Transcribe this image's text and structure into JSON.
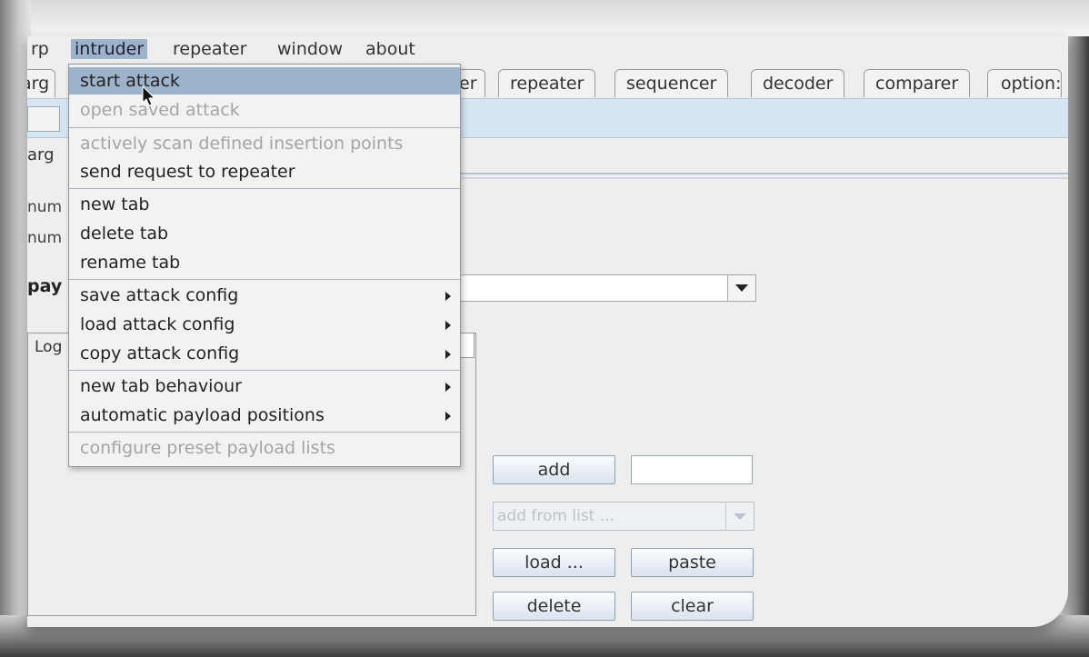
{
  "menubar": {
    "items": [
      {
        "label": "rp"
      },
      {
        "label": "intruder",
        "active": true
      },
      {
        "label": "repeater"
      },
      {
        "label": "window"
      },
      {
        "label": "about"
      }
    ]
  },
  "tabs": [
    {
      "label": "arg"
    },
    {
      "label": "er"
    },
    {
      "label": "repeater"
    },
    {
      "label": "sequencer"
    },
    {
      "label": "decoder"
    },
    {
      "label": "comparer"
    },
    {
      "label": "option:"
    }
  ],
  "subtab_label": "arg",
  "left_labels": {
    "num1": "num",
    "num2": "num",
    "pay": "pay",
    "log": "Log"
  },
  "intruder_menu": {
    "items": [
      {
        "label": "start attack",
        "enabled": true,
        "highlighted": true
      },
      {
        "label": "open saved attack",
        "enabled": false
      },
      {
        "label": "actively scan defined insertion points",
        "enabled": false
      },
      {
        "label": "send request to repeater",
        "enabled": true
      },
      {
        "label": "new tab",
        "enabled": true
      },
      {
        "label": "delete tab",
        "enabled": true
      },
      {
        "label": "rename tab",
        "enabled": true
      },
      {
        "label": "save attack config",
        "enabled": true,
        "submenu": true
      },
      {
        "label": "load attack config",
        "enabled": true,
        "submenu": true
      },
      {
        "label": "copy attack config",
        "enabled": true,
        "submenu": true
      },
      {
        "label": "new tab behaviour",
        "enabled": true,
        "submenu": true
      },
      {
        "label": "automatic payload positions",
        "enabled": true,
        "submenu": true
      },
      {
        "label": "configure preset payload lists",
        "enabled": false
      }
    ]
  },
  "payload_buttons": {
    "add": "add",
    "add_from_list": "add from list ...",
    "load": "load ...",
    "paste": "paste",
    "delete": "delete",
    "clear": "clear"
  },
  "icons": {
    "combo_arrow": "chevron-down-icon",
    "submenu_arrow": "chevron-right-icon",
    "cursor": "mouse-pointer-icon"
  },
  "colors": {
    "highlight": "#9db3cc",
    "tabbar": "#d7e5f3",
    "disabled_text": "#a4a4a4"
  }
}
